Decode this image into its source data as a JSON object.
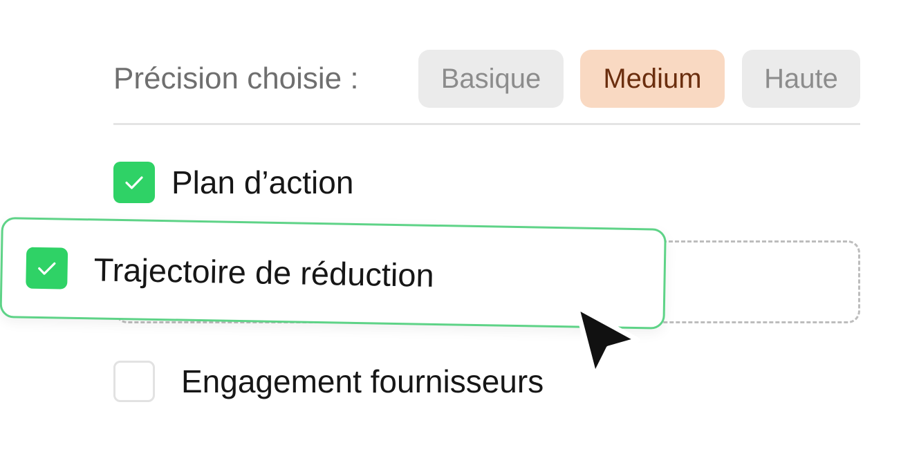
{
  "precision": {
    "label": "Précision choisie :",
    "options": [
      {
        "label": "Basique",
        "selected": false
      },
      {
        "label": "Medium",
        "selected": true
      },
      {
        "label": "Haute",
        "selected": false
      }
    ],
    "selected_color": "#f9d9c2",
    "selected_text_color": "#6b2e0e"
  },
  "items": [
    {
      "label": "Plan d’action",
      "checked": true
    },
    {
      "label": "Trajectoire de réduction",
      "checked": true,
      "state": "dragging"
    },
    {
      "label": "Engagement fournisseurs",
      "checked": false
    }
  ],
  "colors": {
    "check_green": "#2fd266",
    "drag_border": "#5ed387",
    "cursor": "#111111"
  },
  "icons": {
    "checkmark": "check-icon",
    "pointer": "mouse-pointer-icon"
  }
}
